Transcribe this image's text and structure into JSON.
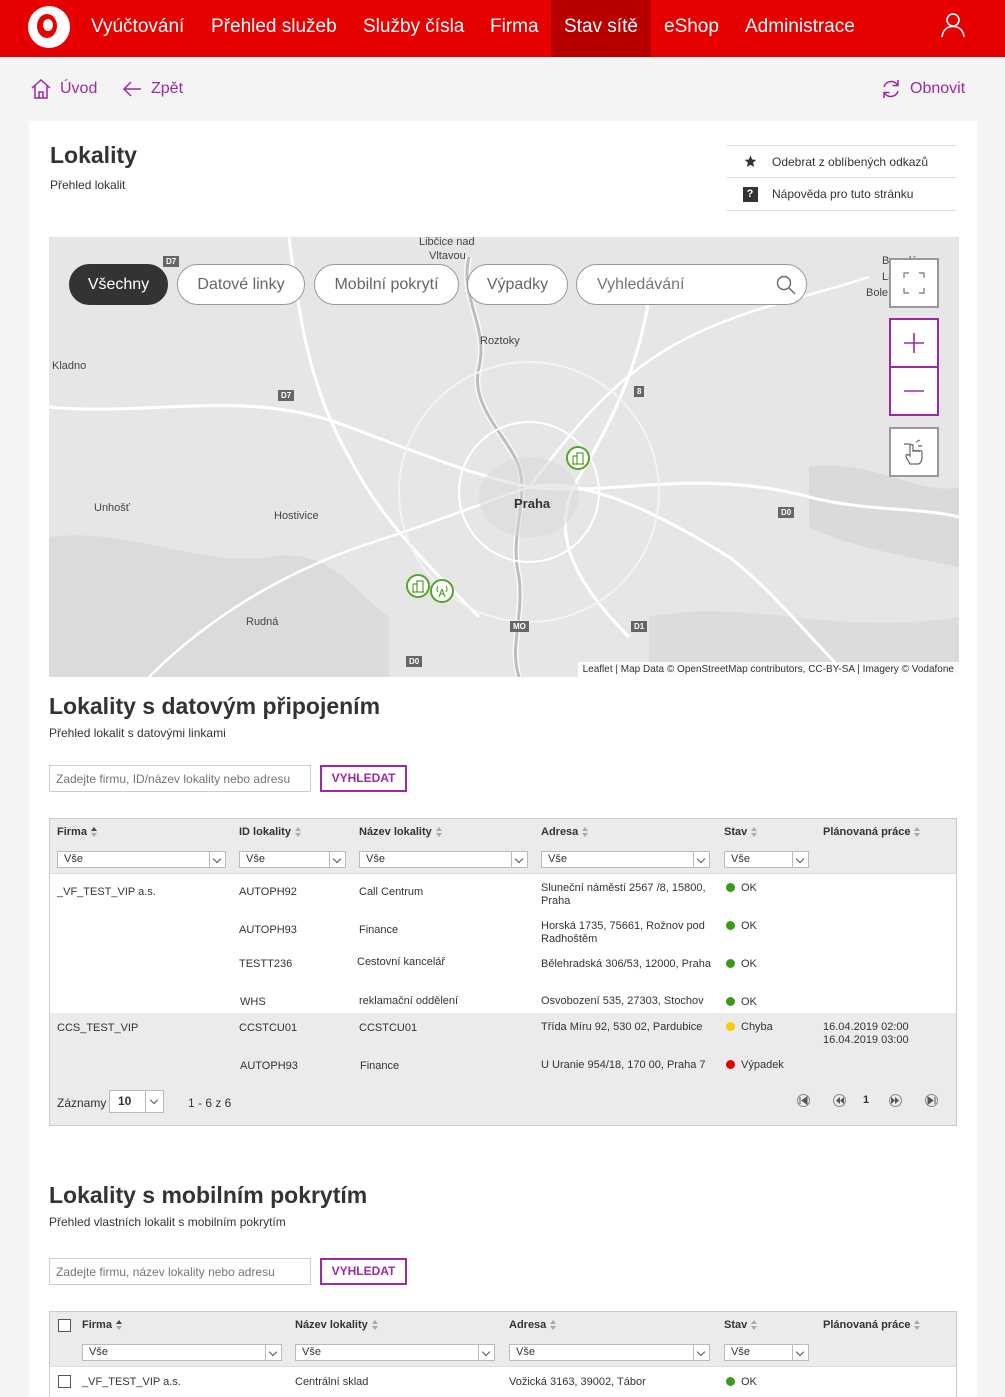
{
  "nav": {
    "items": [
      "Vyúčtování",
      "Přehled služeb",
      "Služby čísla",
      "Firma",
      "Stav sítě",
      "eShop",
      "Administrace"
    ],
    "active": "Stav sítě"
  },
  "breadcrumb": {
    "home": "Úvod",
    "back": "Zpět",
    "refresh": "Obnovit"
  },
  "page": {
    "title": "Lokality",
    "subtitle": "Přehled lokalit"
  },
  "quick_links": {
    "favorite": "Odebrat z oblíbených odkazů",
    "help": "Nápověda pro tuto stránku"
  },
  "map": {
    "filters": [
      "Všechny",
      "Datové linky",
      "Mobilní pokrytí",
      "Výpadky"
    ],
    "active_filter": "Všechny",
    "search_placeholder": "Vyhledávání",
    "labels": {
      "libcice": "Libčice nad",
      "vltavou": "Vltavou",
      "roztoky": "Roztoky",
      "kladno": "Kladno",
      "praha": "Praha",
      "unhost": "Unhošť",
      "hostivice": "Hostivice",
      "rudna": "Rudná",
      "brandys": "Brandý",
      "labem": "Labem",
      "bole": "Bole"
    },
    "road_signs": [
      "D7",
      "D7",
      "8",
      "D0",
      "MO",
      "D1",
      "D0"
    ],
    "attribution": "Leaflet | Map Data © OpenStreetMap contributors, CC-BY-SA | Imagery © Vodafone"
  },
  "data_section": {
    "title": "Lokality s datovým připojením",
    "subtitle": "Přehled lokalit s datovými linkami",
    "search_placeholder": "Zadejte firmu, ID/název lokality nebo adresu",
    "search_button": "VYHLEDAT",
    "columns": [
      "Firma",
      "ID lokality",
      "Název lokality",
      "Adresa",
      "Stav",
      "Plánovaná práce"
    ],
    "filter_value": "Vše",
    "rows": [
      {
        "firma": "_VF_TEST_VIP a.s.",
        "id": "AUTOPH92",
        "nazev": "Call Centrum",
        "adresa1": "Sluneční náměstí 2567 /8, 15800,",
        "adresa2": "Praha",
        "stav": "OK",
        "prace1": "",
        "prace2": ""
      },
      {
        "firma": "",
        "id": "AUTOPH93",
        "nazev": "Finance",
        "adresa1": "Horská 1735, 75661, Rožnov pod",
        "adresa2": "Radhoštěm",
        "stav": "OK",
        "prace1": "",
        "prace2": ""
      },
      {
        "firma": "",
        "id": "TESTT236",
        "nazev": "Cestovní kancelář",
        "adresa1": "Bělehradská 306/53, 12000, Praha",
        "adresa2": "",
        "stav": "OK",
        "prace1": "",
        "prace2": ""
      },
      {
        "firma": "",
        "id": "WHS",
        "nazev": "reklamační oddělení",
        "adresa1": "Osvobození 535, 27303, Stochov",
        "adresa2": "",
        "stav": "OK",
        "prace1": "",
        "prace2": ""
      },
      {
        "firma": "CCS_TEST_VIP",
        "id": "CCSTCU01",
        "nazev": "CCSTCU01",
        "adresa1": "Třída Míru 92, 530 02, Pardubice",
        "adresa2": "",
        "stav": "Chyba",
        "prace1": "16.04.2019 02:00",
        "prace2": "16.04.2019 03:00"
      },
      {
        "firma": "",
        "id": "AUTOPH93",
        "nazev": "Finance",
        "adresa1": "U Uranie 954/18, 170 00, Praha 7",
        "adresa2": "",
        "stav": "Výpadek",
        "prace1": "",
        "prace2": ""
      }
    ],
    "pager": {
      "label": "Záznamy",
      "page_size": "10",
      "range": "1 - 6 z 6",
      "current_page": "1"
    }
  },
  "mobile_section": {
    "title": "Lokality s mobilním pokrytím",
    "subtitle": "Přehled vlastních lokalit s mobilním pokrytím",
    "search_placeholder": "Zadejte firmu, název lokality nebo adresu",
    "search_button": "VYHLEDAT",
    "columns": [
      "Firma",
      "Název lokality",
      "Adresa",
      "Stav",
      "Plánovaná práce"
    ],
    "filter_value": "Vše",
    "rows": [
      {
        "firma": "_VF_TEST_VIP a.s.",
        "nazev": "Centrální sklad",
        "adresa": "Vožická 3163, 39002, Tábor",
        "stav": "OK"
      }
    ]
  },
  "colors": {
    "brand": "#e60000",
    "accent": "#9c2aa0",
    "ok": "#3a9a1a",
    "warn": "#ffc800",
    "error": "#e60000"
  }
}
